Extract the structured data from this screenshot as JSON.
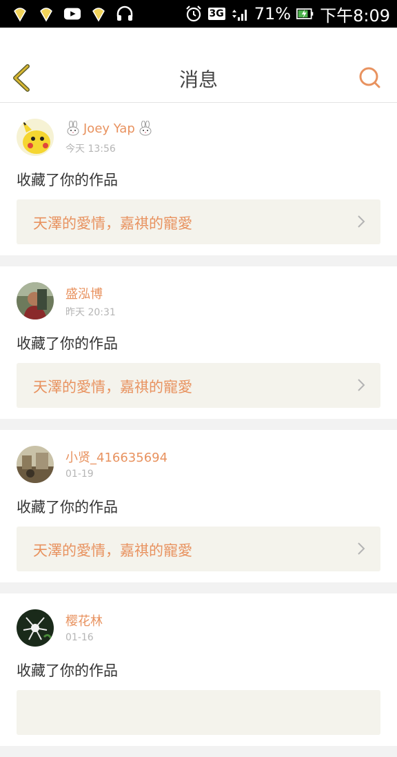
{
  "status_bar": {
    "network": "3G",
    "battery": "71%",
    "time": "下午8:09"
  },
  "header": {
    "title": "消息"
  },
  "icons": {
    "back": "chevron-left-icon",
    "search": "search-icon"
  },
  "colors": {
    "accent": "#e8925f",
    "back_icon": "#d8b733",
    "card_link_bg": "#f4f3ec"
  },
  "messages": [
    {
      "username": "Joey Yap",
      "time": "今天 13:56",
      "action": "收藏了你的作品",
      "work_title": "天澤的愛情，嘉祺的寵愛"
    },
    {
      "username": "盛泓博",
      "time": "昨天 20:31",
      "action": "收藏了你的作品",
      "work_title": "天澤的愛情，嘉祺的寵愛"
    },
    {
      "username": "小贤_416635694",
      "time": "01-19",
      "action": "收藏了你的作品",
      "work_title": "天澤的愛情，嘉祺的寵愛"
    },
    {
      "username": "樱花林",
      "time": "01-16",
      "action": "收藏了你的作品",
      "work_title": ""
    }
  ]
}
